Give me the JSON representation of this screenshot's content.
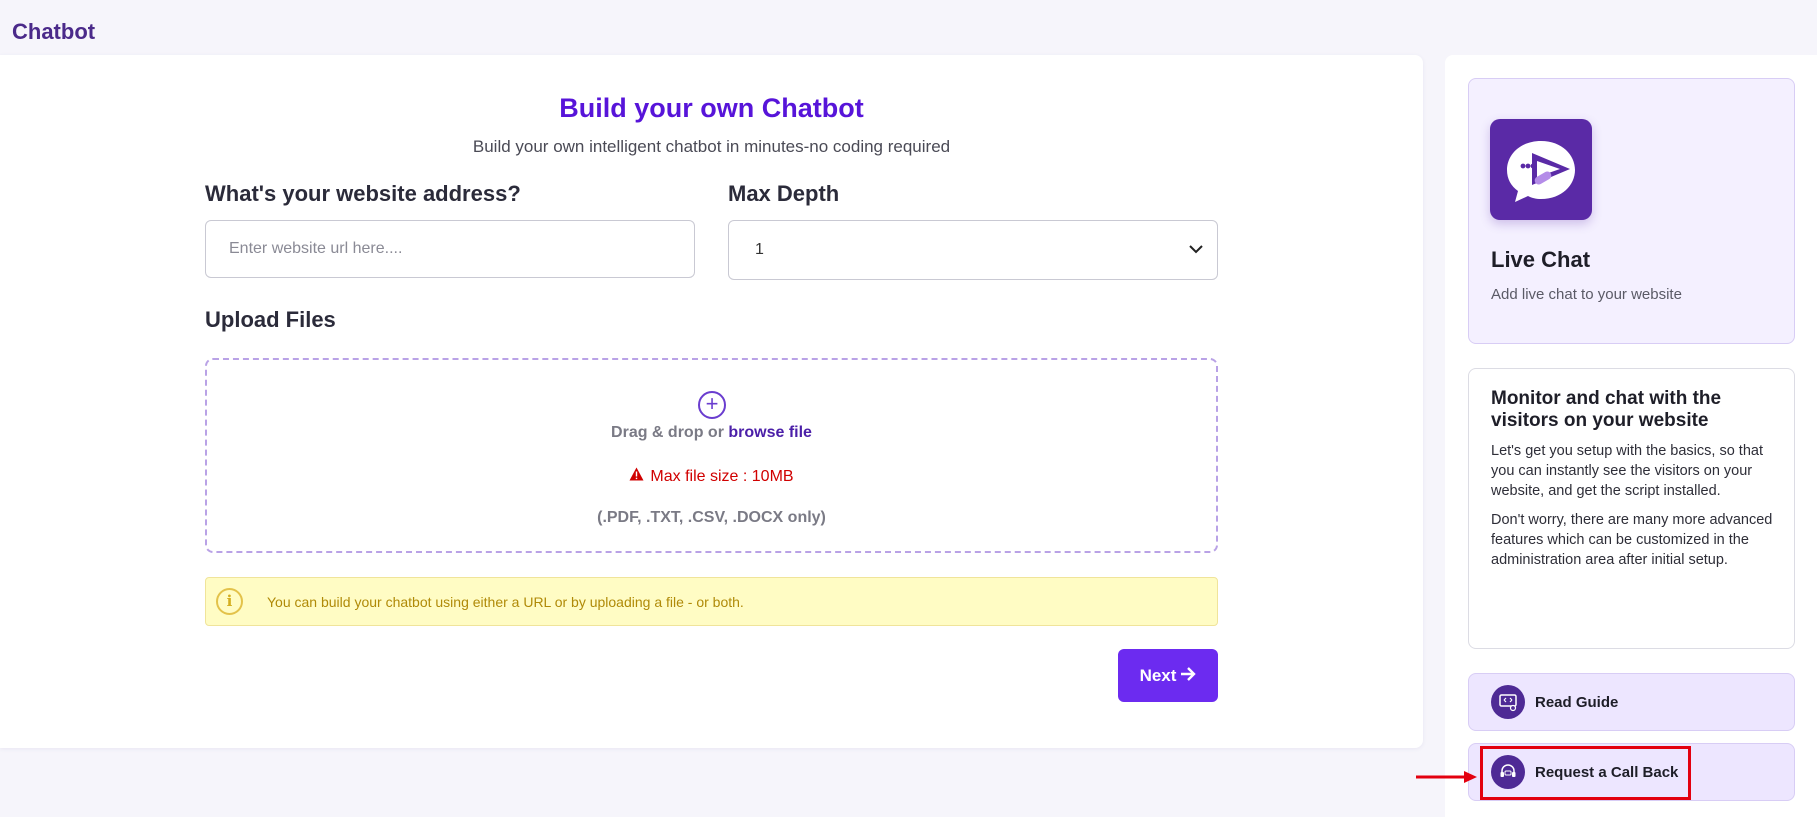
{
  "page": {
    "title": "Chatbot"
  },
  "builder": {
    "heading": "Build your own Chatbot",
    "subheading": "Build your own intelligent chatbot in minutes-no coding required",
    "url_label": "What's your website address?",
    "url_placeholder": "Enter website url here....",
    "url_value": "",
    "depth_label": "Max Depth",
    "depth_value": "1",
    "upload_label": "Upload Files",
    "drag_text": "Drag & drop or",
    "browse_text": "browse file",
    "max_size": "Max file size : 10MB",
    "formats": "(.PDF, .TXT, .CSV, .DOCX only)",
    "info_text": "You can build your chatbot using either a URL or by uploading a file - or both.",
    "next_label": "Next"
  },
  "sidebar": {
    "livechat_title": "Live Chat",
    "livechat_sub": "Add live chat to your website",
    "monitor_title": "Monitor and chat with the visitors on your website",
    "monitor_p1": "Let's get you setup with the basics, so that you can instantly see the visitors on your website, and get the script installed.",
    "monitor_p2": "Don't worry, there are many more advanced features which can be customized in the administration area after initial setup.",
    "read_guide": "Read Guide",
    "request_callback": "Request a Call Back"
  },
  "colors": {
    "accent": "#6c2bf0",
    "heading": "#5714d9",
    "brand_dark": "#4e2a95",
    "warning": "#d00000",
    "info_bg": "#fffcc4",
    "annotation": "#e3000f"
  }
}
